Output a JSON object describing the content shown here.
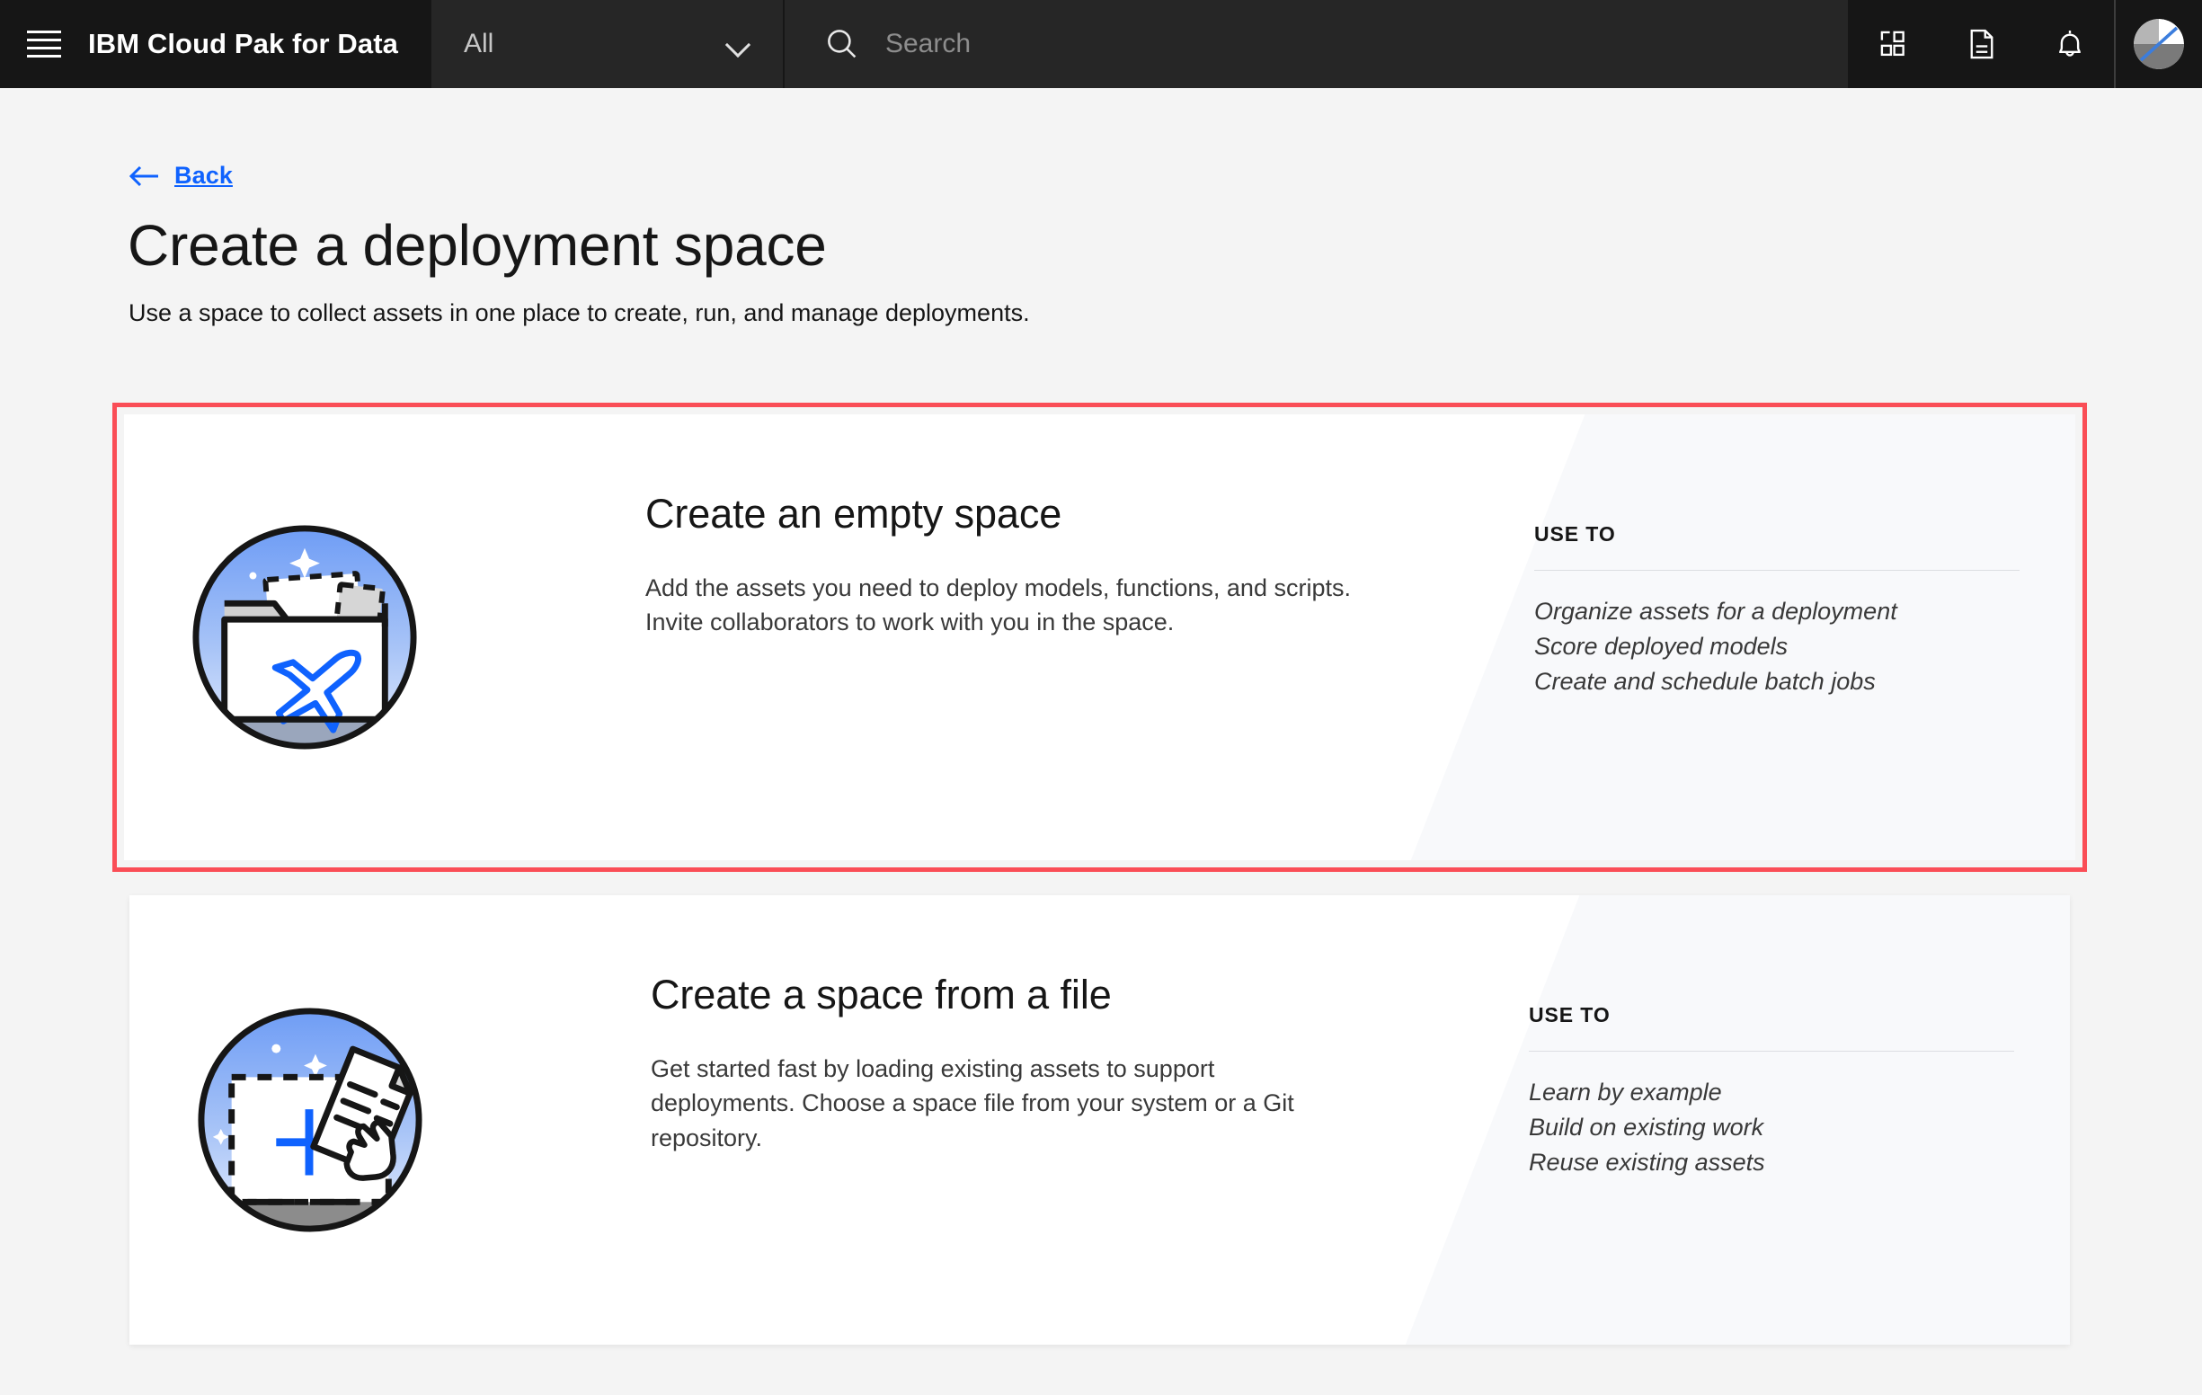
{
  "header": {
    "menu_icon": "hamburger-menu-icon",
    "brand": "IBM Cloud Pak for Data",
    "scope": {
      "value": "All",
      "chevron_icon": "chevron-down-icon"
    },
    "search": {
      "placeholder": "Search",
      "icon": "search-icon"
    },
    "actions": [
      {
        "name": "app-switcher-button",
        "icon": "app-switcher-icon"
      },
      {
        "name": "docs-button",
        "icon": "document-icon"
      },
      {
        "name": "notifications-button",
        "icon": "bell-icon"
      }
    ],
    "avatar": {
      "name": "user-avatar",
      "icon": "avatar-icon"
    },
    "colors": {
      "bar": "#161616",
      "field": "#262626",
      "text": "#ffffff",
      "muted": "#8d8d8d"
    }
  },
  "page": {
    "back": {
      "label": "Back",
      "icon": "arrow-left-icon",
      "color": "#0f62fe"
    },
    "title": "Create a deployment space",
    "subtitle": "Use a space to collect assets in one place to create, run, and manage deployments.",
    "background": "#f4f4f4"
  },
  "cards": [
    {
      "name": "create-empty-space-card",
      "selected": true,
      "selection_color": "#fa4d56",
      "illustration": "folder-rocket-illustration",
      "heading": "Create an empty space",
      "description": "Add the assets you need to deploy models, functions, and scripts. Invite collaborators to work with you in the space.",
      "use_to_label": "USE TO",
      "use_to_items": [
        "Organize assets for a deployment",
        "Score deployed models",
        "Create and schedule batch jobs"
      ]
    },
    {
      "name": "create-space-from-file-card",
      "selected": false,
      "selection_color": "",
      "illustration": "dashed-square-file-hand-illustration",
      "heading": "Create a space from a file",
      "description": "Get started fast by loading existing assets to support deployments. Choose a space file from your system or a Git repository.",
      "use_to_label": "USE TO",
      "use_to_items": [
        "Learn by example",
        "Build on existing work",
        "Reuse existing assets"
      ]
    }
  ]
}
